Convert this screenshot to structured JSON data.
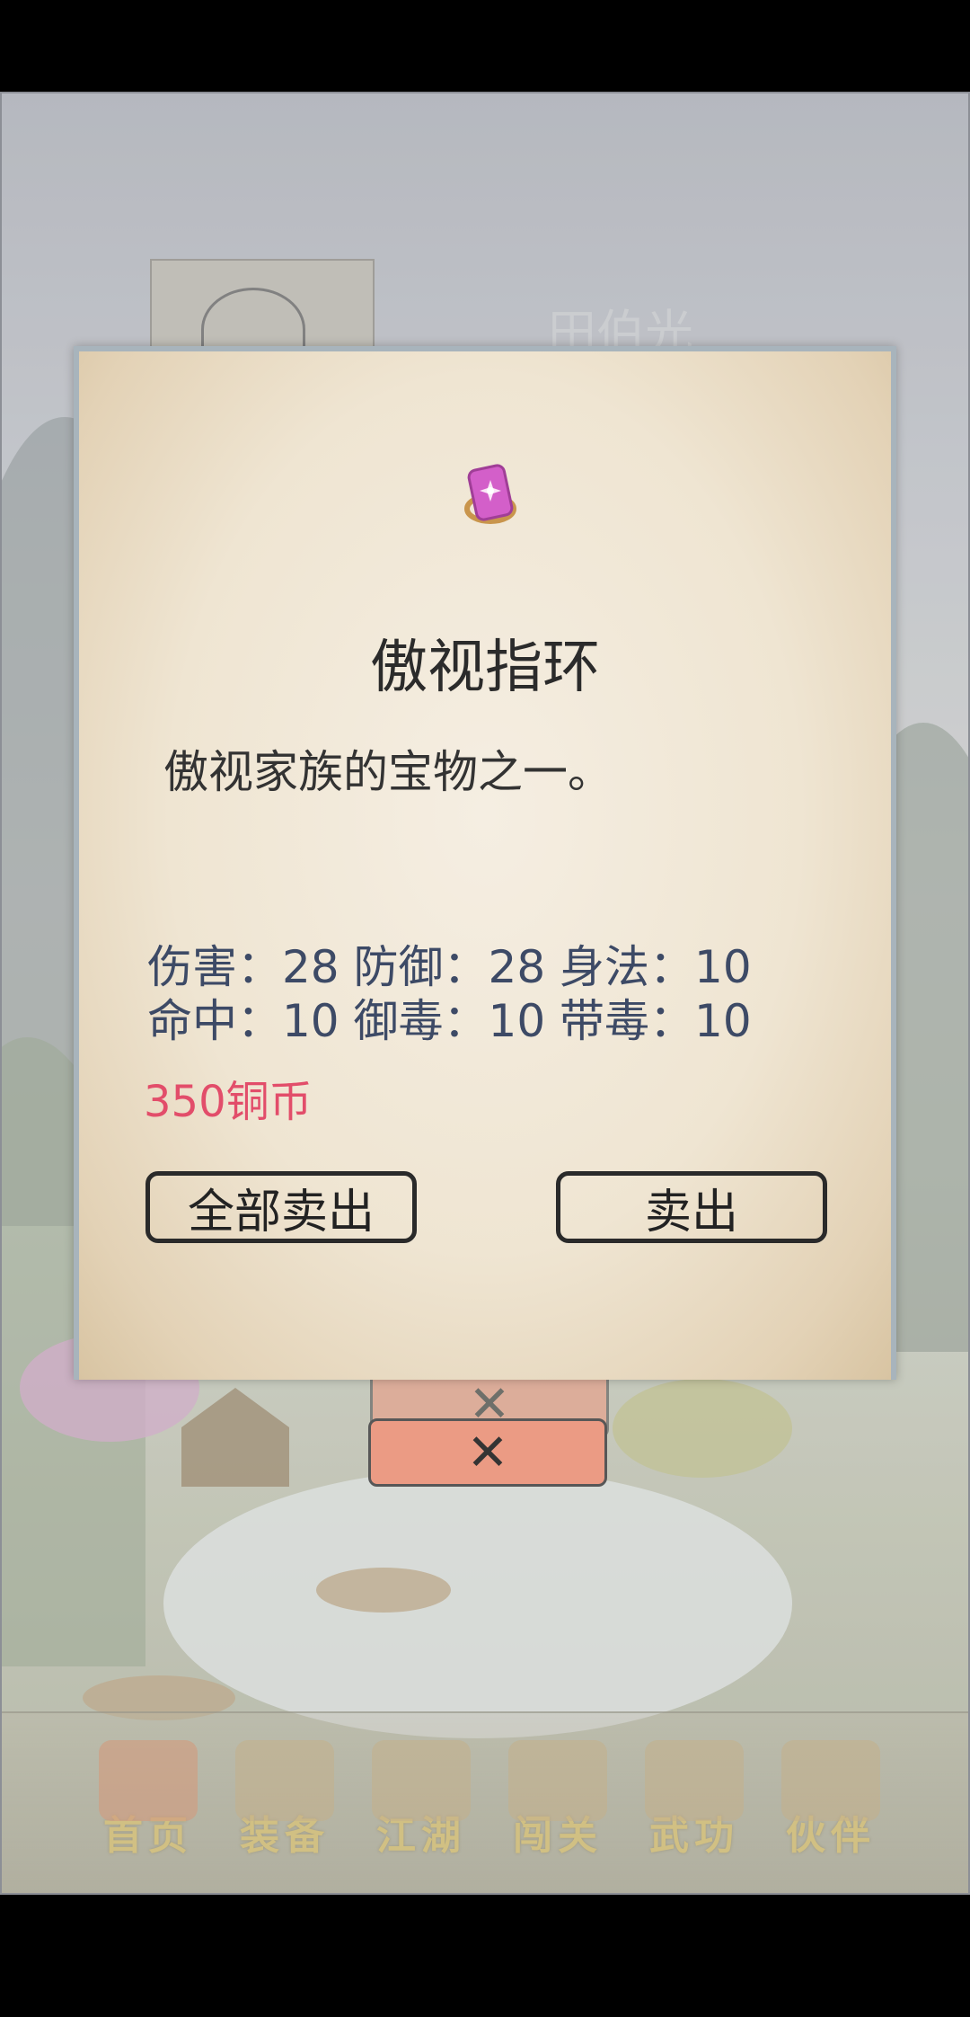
{
  "background": {
    "character_name": "田伯光",
    "close_symbol": "✕",
    "nav": [
      {
        "label": "首页",
        "icon": "home-pavilion-icon",
        "active": true
      },
      {
        "label": "装备",
        "icon": "armor-icon",
        "active": false
      },
      {
        "label": "江湖",
        "icon": "scroll-map-icon",
        "active": false
      },
      {
        "label": "闯关",
        "icon": "crossed-swords-icon",
        "active": false
      },
      {
        "label": "武功",
        "icon": "martial-book-icon",
        "active": false
      },
      {
        "label": "伙伴",
        "icon": "companions-icon",
        "active": false
      }
    ]
  },
  "dialog": {
    "item_icon": "ring-icon",
    "item_name": "傲视指环",
    "description": "傲视家族的宝物之一。",
    "stats_line1": "伤害：28 防御：28 身法：10",
    "stats_line2": "命中：10 御毒：10 带毒：10",
    "price": "350铜币",
    "sell_all_label": "全部卖出",
    "sell_label": "卖出"
  },
  "colors": {
    "price": "#e24d6a",
    "stats": "#3d4a66",
    "close_button": "#e88a6f"
  }
}
